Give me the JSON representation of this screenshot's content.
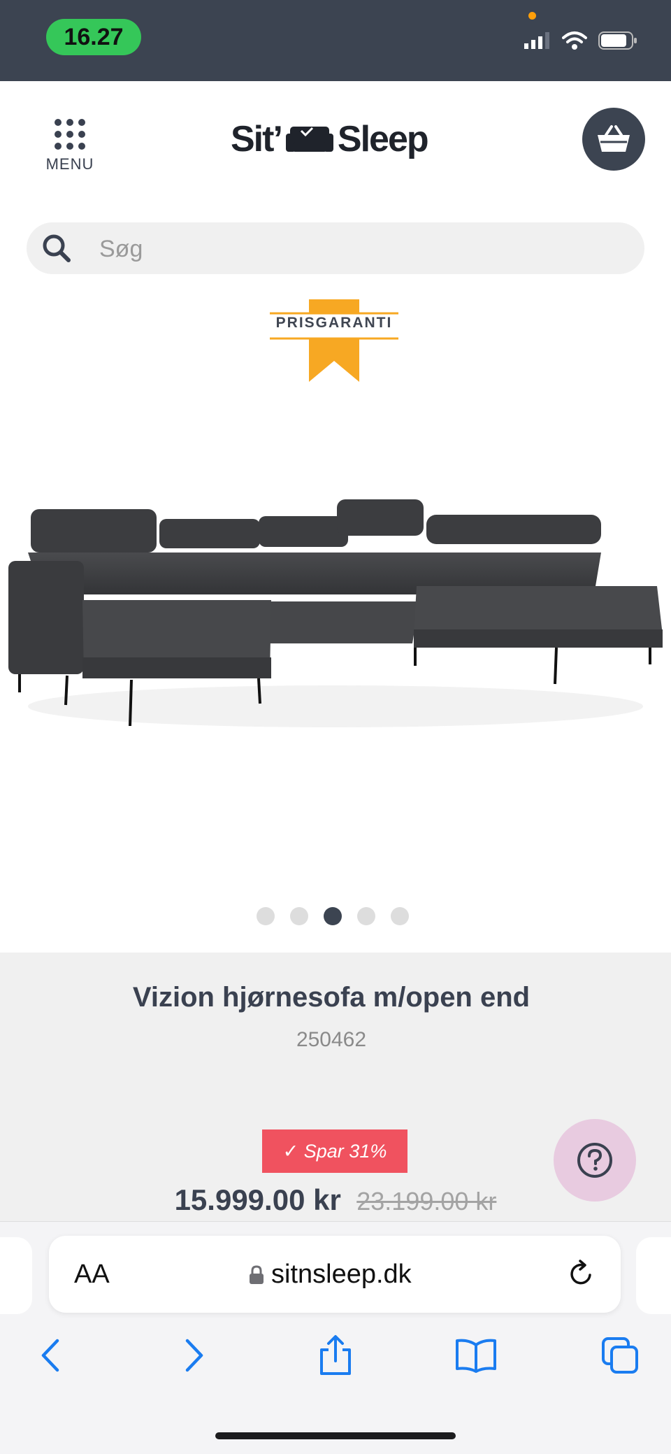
{
  "status_bar": {
    "time": "16.27"
  },
  "header": {
    "menu_label": "MENU",
    "logo_left": "Sit’",
    "logo_right": "Sleep"
  },
  "search": {
    "placeholder": "Søg"
  },
  "badge": {
    "text": "PRISGARANTI"
  },
  "carousel": {
    "count": 5,
    "active_index": 2
  },
  "product": {
    "name": "Vizion hjørnesofa m/open end",
    "sku": "250462",
    "save_label": "✓  Spar 31%",
    "price": "15.999.00 kr",
    "old_price": "23.199.00 kr"
  },
  "browser": {
    "aa_label": "AA",
    "url": "sitnsleep.dk"
  },
  "colors": {
    "status_bar": "#3c4451",
    "time_pill": "#35c759",
    "badge_gold": "#f7a823",
    "save_badge": "#f0525f",
    "help_button": "#e8cbe0",
    "ios_blue": "#1a7cf0"
  },
  "icons": [
    "menu-grid-icon",
    "sofa-logo-icon",
    "basket-icon",
    "search-icon",
    "question-icon",
    "lock-icon",
    "reload-icon",
    "back-icon",
    "forward-icon",
    "share-icon",
    "bookmarks-icon",
    "tabs-icon",
    "signal-icon",
    "wifi-icon",
    "battery-icon"
  ]
}
